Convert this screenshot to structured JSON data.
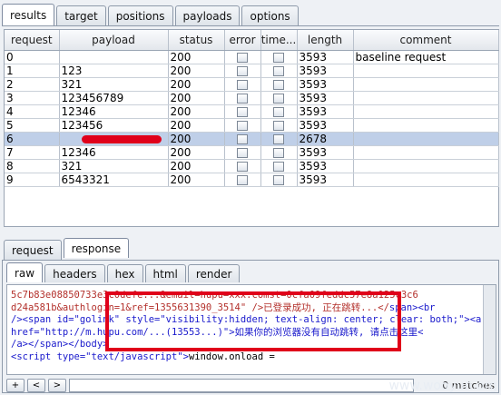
{
  "top_tabs": [
    "results",
    "target",
    "positions",
    "payloads",
    "options"
  ],
  "columns": [
    "request",
    "payload",
    "status",
    "error",
    "time...",
    "length",
    "comment"
  ],
  "rows": [
    {
      "request": "0",
      "payload": "",
      "status": "200",
      "length": "3593",
      "comment": "baseline request"
    },
    {
      "request": "1",
      "payload": "123",
      "status": "200",
      "length": "3593",
      "comment": ""
    },
    {
      "request": "2",
      "payload": "321",
      "status": "200",
      "length": "3593",
      "comment": ""
    },
    {
      "request": "3",
      "payload": "123456789",
      "status": "200",
      "length": "3593",
      "comment": ""
    },
    {
      "request": "4",
      "payload": "12346",
      "status": "200",
      "length": "3593",
      "comment": ""
    },
    {
      "request": "5",
      "payload": "123456",
      "status": "200",
      "length": "3593",
      "comment": ""
    },
    {
      "request": "6",
      "payload": "",
      "status": "200",
      "length": "2678",
      "comment": "",
      "selected": true
    },
    {
      "request": "7",
      "payload": "12346",
      "status": "200",
      "length": "3593",
      "comment": ""
    },
    {
      "request": "8",
      "payload": "321",
      "status": "200",
      "length": "3593",
      "comment": ""
    },
    {
      "request": "9",
      "payload": "6543321",
      "status": "200",
      "length": "3593",
      "comment": ""
    }
  ],
  "rr_tabs": [
    "request",
    "response"
  ],
  "sub_tabs": [
    "raw",
    "headers",
    "hex",
    "html",
    "render"
  ],
  "editor": {
    "line1": "5c7b83e08850733e3c0defe...&email=hupu=xxx.comst=0cfa09feddc57e8a125c3c6",
    "line2a": "d24a581b&authlogin=1&ref=1355631390_3514\" />已登录成功, 正在跳转...</",
    "line2b": "span",
    "line2c": "><br",
    "line3a": "/><span id=\"golink\" style=\"visibility:hidden; text-align: center; clear: both;\"><a",
    "line4a": "href=\"http://m.hupu.com/...(13553...)\">如果你的浏览器没有自动跳转, 请点击这里<",
    "line5a": "/a></span></body>",
    "line6a": "<script type=\"text/javascript\">",
    "line6b": "window.onload ="
  },
  "bottom": {
    "plus": "+",
    "prev": "<",
    "next": ">",
    "matches": "0 matches"
  },
  "watermark": "www.wooyun.org",
  "colors": {
    "highlight": "#e0001a",
    "selected_row": "#bfcfe8"
  }
}
